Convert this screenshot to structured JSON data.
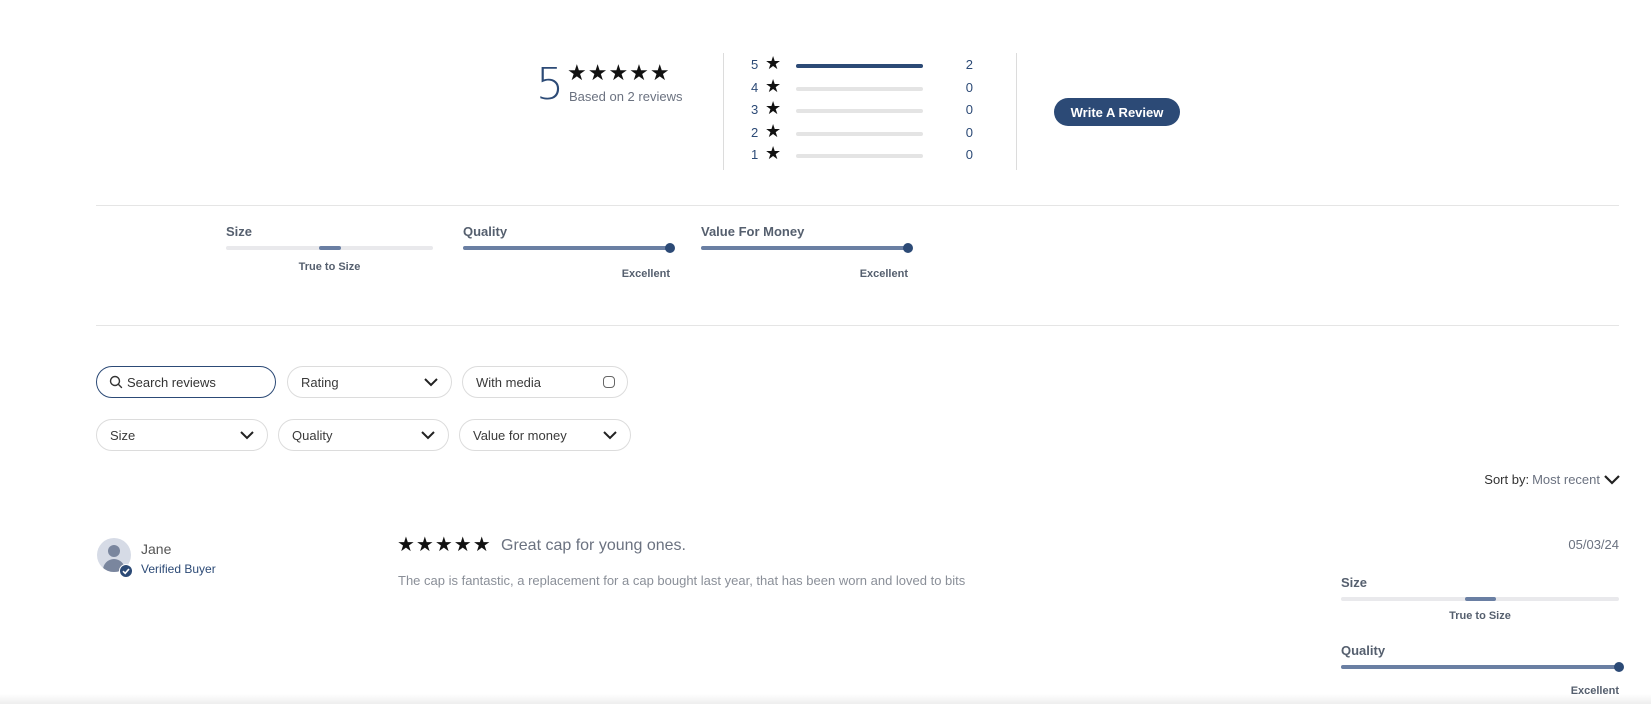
{
  "summary": {
    "average": "5",
    "stars": "★★★★★",
    "based_on": "Based on 2 reviews",
    "histogram": [
      {
        "rating": "5",
        "count": "2",
        "fraction": 1.0
      },
      {
        "rating": "4",
        "count": "0",
        "fraction": 0.0
      },
      {
        "rating": "3",
        "count": "0",
        "fraction": 0.0
      },
      {
        "rating": "2",
        "count": "0",
        "fraction": 0.0
      },
      {
        "rating": "1",
        "count": "0",
        "fraction": 0.0
      }
    ],
    "star_glyph": "★",
    "write_review_label": "Write A Review"
  },
  "attributes": [
    {
      "label": "Size",
      "value": "True to Size",
      "level": 0.5,
      "style": "center"
    },
    {
      "label": "Quality",
      "value": "Excellent",
      "level": 1.0,
      "style": "max"
    },
    {
      "label": "Value For Money",
      "value": "Excellent",
      "level": 1.0,
      "style": "max"
    }
  ],
  "filters": {
    "search_placeholder": "Search reviews",
    "rating": "Rating",
    "with_media": "With media",
    "size": "Size",
    "quality": "Quality",
    "value_for_money": "Value for money"
  },
  "sort": {
    "label": "Sort by:",
    "value": "Most recent"
  },
  "reviews": [
    {
      "author": "Jane",
      "badge": "Verified Buyer",
      "stars": "★★★★★",
      "rating": 5,
      "title": "Great cap for young ones.",
      "date": "05/03/24",
      "body": "The cap is fantastic, a replacement for a cap bought last year, that has been worn and loved to bits",
      "attributes": [
        {
          "label": "Size",
          "value": "True to Size",
          "level": 0.5
        },
        {
          "label": "Quality",
          "value": "Excellent",
          "level": 1.0
        }
      ]
    }
  ],
  "colors": {
    "brand": "#2c4a76",
    "track": "#e4e4e4",
    "segment": "#6a7fa3"
  }
}
